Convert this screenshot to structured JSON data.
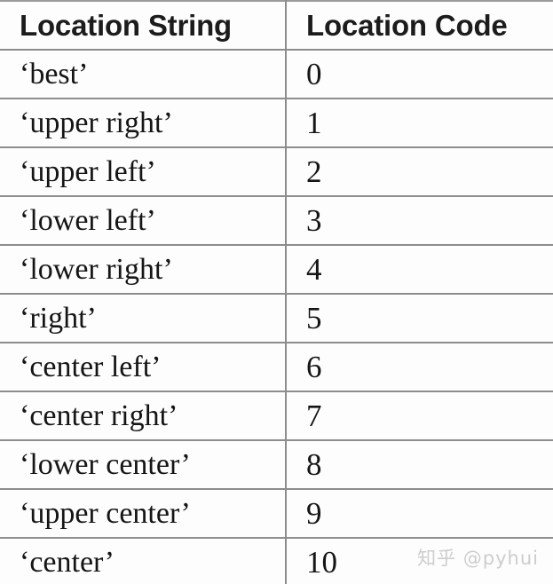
{
  "table": {
    "columns": [
      {
        "key": "location_string",
        "label": "Location String"
      },
      {
        "key": "location_code",
        "label": "Location Code"
      }
    ],
    "rows": [
      {
        "location_string": "‘best’",
        "location_code": "0"
      },
      {
        "location_string": "‘upper right’",
        "location_code": "1"
      },
      {
        "location_string": "‘upper left’",
        "location_code": "2"
      },
      {
        "location_string": "‘lower left’",
        "location_code": "3"
      },
      {
        "location_string": "‘lower right’",
        "location_code": "4"
      },
      {
        "location_string": "‘right’",
        "location_code": "5"
      },
      {
        "location_string": "‘center left’",
        "location_code": "6"
      },
      {
        "location_string": "‘center right’",
        "location_code": "7"
      },
      {
        "location_string": "‘lower center’",
        "location_code": "8"
      },
      {
        "location_string": "‘upper center’",
        "location_code": "9"
      },
      {
        "location_string": "‘center’",
        "location_code": "10"
      }
    ]
  },
  "watermark": {
    "text": "知乎 @pyhui",
    "color": "#cdcdcd"
  },
  "colors": {
    "background": "#fdfdfd",
    "border": "#8d8d8d",
    "header_text": "#1c1c1c",
    "body_text": "#151515"
  }
}
